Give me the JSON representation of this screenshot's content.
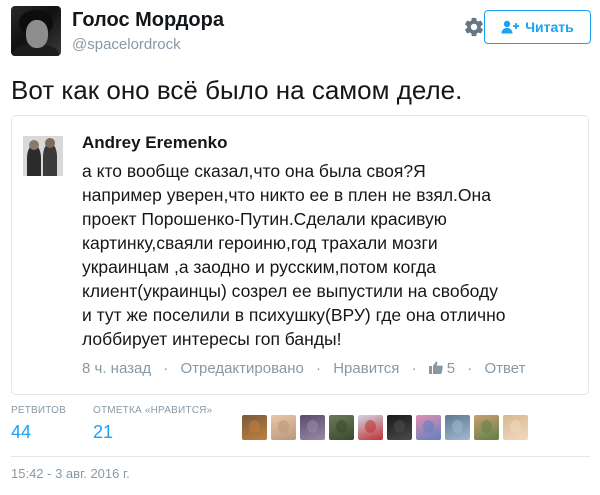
{
  "author": {
    "display_name": "Голос Мордора",
    "screen_name": "@spacelordrock"
  },
  "follow_button": {
    "label": "Читать",
    "icon": "follow-person-icon"
  },
  "settings_icon": "gear-icon",
  "tweet_text": "Вот как оно всё было на самом деле.",
  "quote": {
    "author_name": "Andrey Eremenko",
    "lines": [
      "а кто вообще сказал,что она была своя?Я",
      "например уверен,что никто ее в плен не взял.Она",
      "проект Порошенко-Путин.Сделали красивую",
      "картинку,сваяли героиню,год трахали мозги",
      "украинцам ,а заодно и русским,потом когда",
      "клиент(украинцы) созрел ее выпустили на свободу",
      "и тут же поселили в психушку(ВРУ) где она отлично",
      "лоббирует интересы гоп банды!"
    ],
    "time": "8 ч. назад",
    "edited": "Отредактировано",
    "like_action": "Нравится",
    "like_count": "5",
    "reply": "Ответ"
  },
  "stats": {
    "retweets_label": "РЕТВИТОВ",
    "retweets": "44",
    "likes_label": "ОТМЕТКА «НРАВИТСЯ»",
    "likes": "21"
  },
  "liker_avatars": [
    {
      "c1": "#7a5a3a",
      "c2": "#c08040"
    },
    {
      "c1": "#e8c8a8",
      "c2": "#b89878"
    },
    {
      "c1": "#5a4a6a",
      "c2": "#9a8aaa"
    },
    {
      "c1": "#6a7a5a",
      "c2": "#3a4a2a"
    },
    {
      "c1": "#d0d8e8",
      "c2": "#c03030"
    },
    {
      "c1": "#1a1a1a",
      "c2": "#4a4a4a"
    },
    {
      "c1": "#e090b0",
      "c2": "#6080c0"
    },
    {
      "c1": "#607890",
      "c2": "#a0b8d0"
    },
    {
      "c1": "#c8a070",
      "c2": "#608048"
    },
    {
      "c1": "#d8b890",
      "c2": "#f0d8c0"
    }
  ],
  "timestamp": "15:42 - 3 авг. 2016 г.",
  "colors": {
    "accent": "#1da1f2",
    "secondary_text": "#8899a6",
    "border": "#e1e8ed"
  }
}
